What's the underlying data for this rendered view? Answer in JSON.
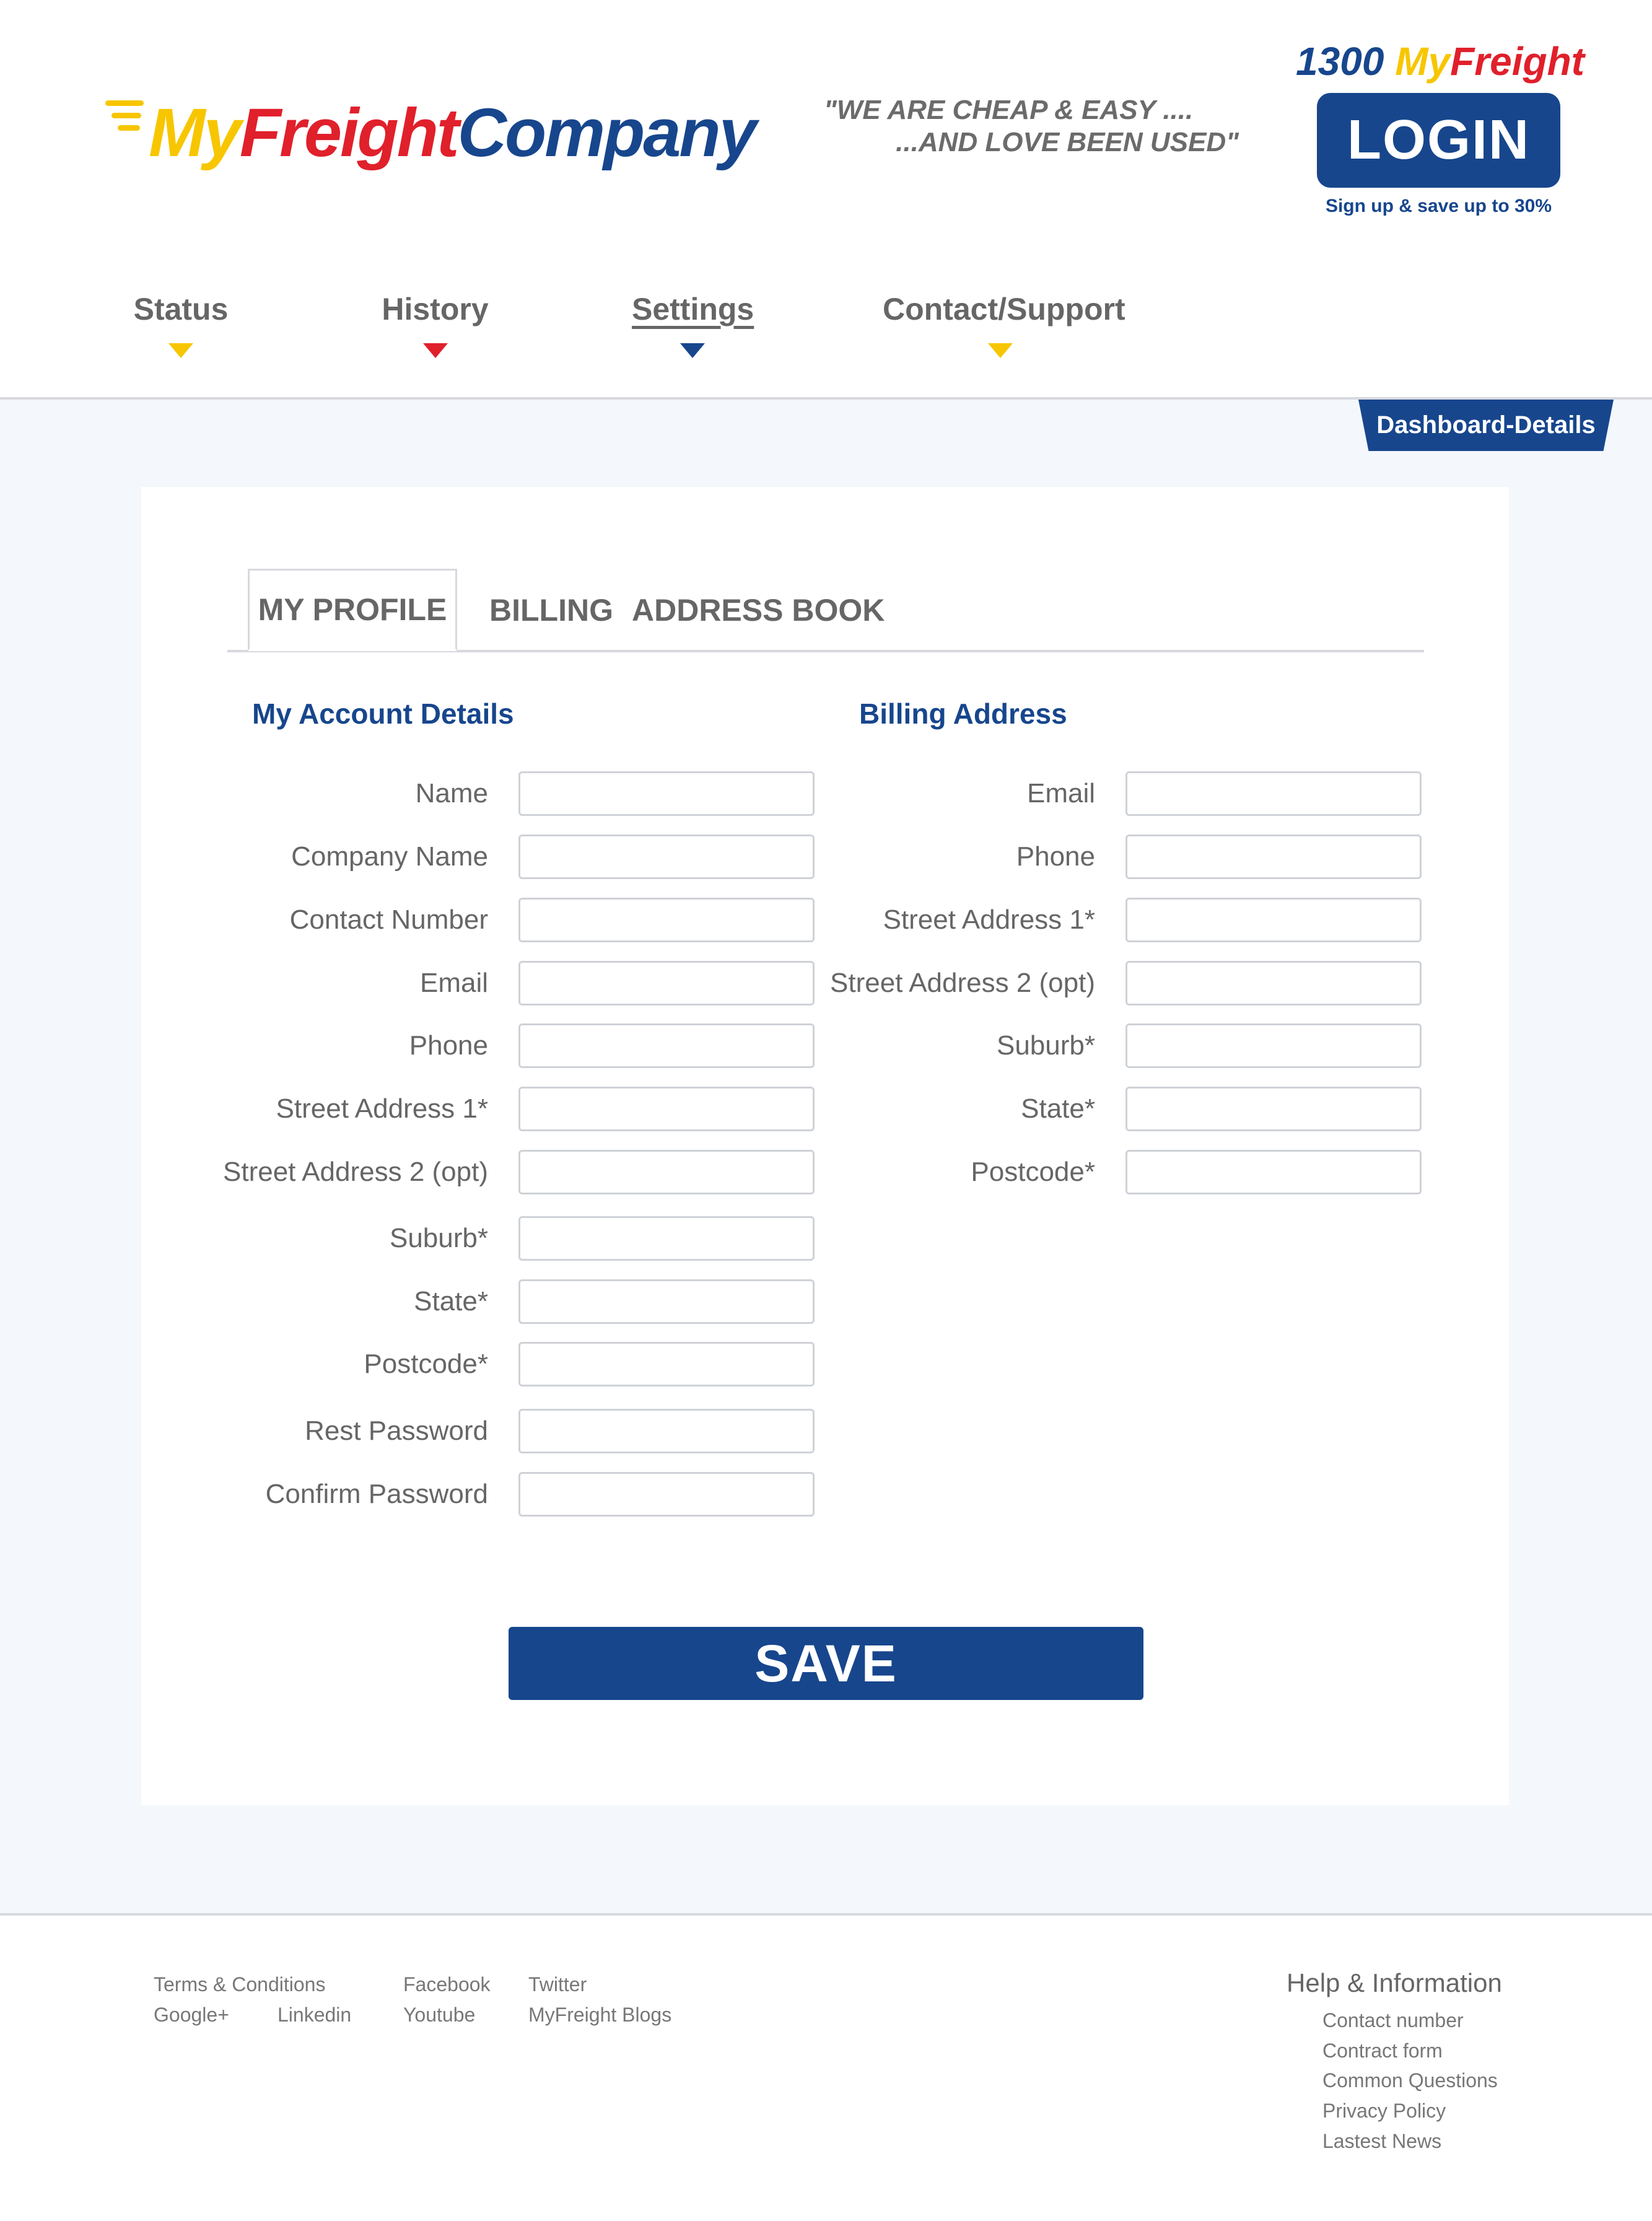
{
  "header": {
    "logo": {
      "part1": "My",
      "part2": "Freight",
      "part3": "Company"
    },
    "tagline": {
      "line1": "\"WE ARE CHEAP & EASY ....",
      "line2": "...AND LOVE BEEN USED\""
    },
    "phone": {
      "number": "1300",
      "my": "My",
      "freight": "Freight"
    },
    "login_label": "LOGIN",
    "signup_text": "Sign up & save up to 30%"
  },
  "nav": {
    "items": [
      {
        "label": "Status",
        "color": "#f7c600"
      },
      {
        "label": "History",
        "color": "#e0202b"
      },
      {
        "label": "Settings",
        "color": "#17468d"
      },
      {
        "label": "Contact/Support",
        "color": "#f7c600"
      }
    ],
    "active": "Settings"
  },
  "dashboard_tab": "Dashboard-Details",
  "tabs": [
    {
      "label": "MY PROFILE",
      "active": true
    },
    {
      "label": "BILLING",
      "active": false
    },
    {
      "label": "ADDRESS BOOK",
      "active": false
    }
  ],
  "account": {
    "title": "My Account Details",
    "fields": [
      {
        "label": "Name",
        "value": ""
      },
      {
        "label": "Company Name",
        "value": ""
      },
      {
        "label": "Contact Number",
        "value": ""
      },
      {
        "label": "Email",
        "value": ""
      },
      {
        "label": "Phone",
        "value": ""
      },
      {
        "label": "Street Address 1*",
        "value": ""
      },
      {
        "label": "Street Address 2 (opt)",
        "value": ""
      },
      {
        "label": "Suburb*",
        "value": ""
      },
      {
        "label": "State*",
        "value": ""
      },
      {
        "label": "Postcode*",
        "value": ""
      },
      {
        "label": "Rest Password",
        "value": ""
      },
      {
        "label": "Confirm Password",
        "value": ""
      }
    ]
  },
  "billing": {
    "title": "Billing Address",
    "fields": [
      {
        "label": "Email",
        "value": ""
      },
      {
        "label": "Phone",
        "value": ""
      },
      {
        "label": "Street Address 1*",
        "value": ""
      },
      {
        "label": "Street Address 2 (opt)",
        "value": ""
      },
      {
        "label": "Suburb*",
        "value": ""
      },
      {
        "label": "State*",
        "value": ""
      },
      {
        "label": "Postcode*",
        "value": ""
      }
    ]
  },
  "save_label": "SAVE",
  "footer": {
    "links": {
      "terms": "Terms & Conditions",
      "google": "Google+",
      "linkedin": "Linkedin",
      "facebook": "Facebook",
      "youtube": "Youtube",
      "twitter": "Twitter",
      "blogs": "MyFreight Blogs"
    },
    "help_title": "Help & Information",
    "help_links": [
      "Contact number",
      "Contract form",
      "Common Questions",
      "Privacy Policy",
      "Lastest News"
    ]
  },
  "colors": {
    "brand_blue": "#17468d",
    "brand_yellow": "#f7c600",
    "brand_red": "#e0202b",
    "content_bg": "#f4f7fb"
  }
}
